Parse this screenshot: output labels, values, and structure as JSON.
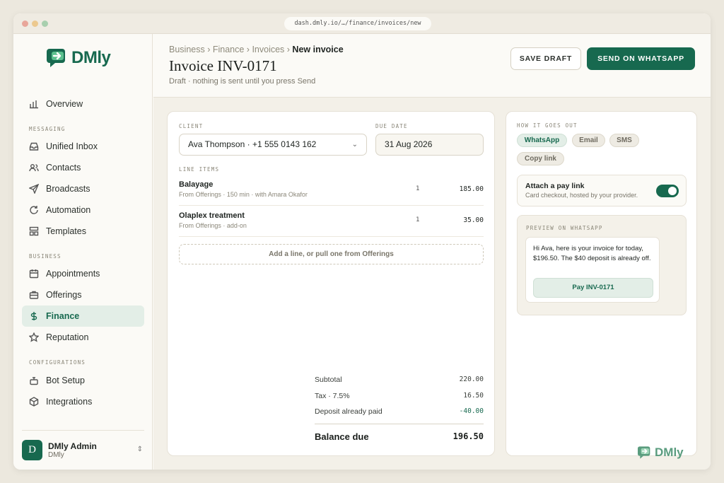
{
  "browser": {
    "url": "dash.dmly.io/…/finance/invoices/new"
  },
  "brand": {
    "name": "DMly",
    "accent": "#17694f"
  },
  "sidebar": {
    "overview": "Overview",
    "sections": {
      "messaging": "MESSAGING",
      "business": "BUSINESS",
      "configurations": "CONFIGURATIONS"
    },
    "items": {
      "inbox": "Unified Inbox",
      "contacts": "Contacts",
      "broadcasts": "Broadcasts",
      "automation": "Automation",
      "templates": "Templates",
      "appointments": "Appointments",
      "offerings": "Offerings",
      "finance": "Finance",
      "reputation": "Reputation",
      "bot_setup": "Bot Setup",
      "integrations": "Integrations"
    },
    "active": "finance",
    "user": {
      "initial": "D",
      "name": "DMly Admin",
      "org": "DMly"
    }
  },
  "header": {
    "breadcrumb": [
      "Business ›",
      "Finance ›",
      "Invoices ›"
    ],
    "breadcrumb_current": "New invoice",
    "title": "Invoice INV-0171",
    "subtitle": "Draft · nothing is sent until you press Send",
    "save_label": "SAVE DRAFT",
    "send_label": "SEND ON WHATSAPP"
  },
  "invoice": {
    "client_label": "CLIENT",
    "client_value": "Ava Thompson · +1 555 0143 162",
    "due_label": "DUE DATE",
    "due_value": "31 Aug 2026",
    "line_items_label": "LINE ITEMS",
    "lines": [
      {
        "name": "Balayage",
        "meta": "From Offerings · 150 min · with Amara Okafor",
        "qty": "1",
        "amount": "185.00"
      },
      {
        "name": "Olaplex treatment",
        "meta": "From Offerings · add-on",
        "qty": "1",
        "amount": "35.00"
      }
    ],
    "add_line_label": "Add a line, or pull one from Offerings",
    "totals": {
      "subtotal_label": "Subtotal",
      "subtotal": "220.00",
      "tax_label": "Tax · 7.5%",
      "tax": "16.50",
      "deposit_label": "Deposit already paid",
      "deposit": "-40.00",
      "balance_label": "Balance due",
      "balance": "196.50"
    }
  },
  "delivery": {
    "label": "HOW IT GOES OUT",
    "channels": [
      "WhatsApp",
      "Email",
      "SMS",
      "Copy link"
    ],
    "selected": "WhatsApp",
    "paylink_title": "Attach a pay link",
    "paylink_sub": "Card checkout, hosted by your provider.",
    "paylink_on": true,
    "preview_label": "PREVIEW ON WHATSAPP",
    "preview_message": "Hi Ava, here is your invoice for today, $196.50. The $40 deposit is already off.",
    "preview_button": "Pay INV-0171"
  }
}
